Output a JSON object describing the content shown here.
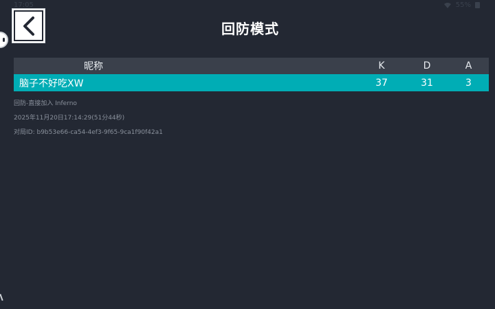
{
  "status_bar": {
    "time": "17:05",
    "battery": "55%"
  },
  "header": {
    "title": "回防模式"
  },
  "table": {
    "columns": {
      "name": "昵称",
      "k": "K",
      "d": "D",
      "a": "A"
    },
    "rows": [
      {
        "name": "脑子不好吃XW",
        "k": "37",
        "d": "31",
        "a": "3"
      }
    ]
  },
  "match_info": {
    "mode_map": "回防-直接加入 Inferno",
    "datetime": "2025年11月20日17:14:29(51分44秒)",
    "match_id": "对局ID: b9b53e66-ca54-4ef3-9f65-9ca1f90f42a1"
  },
  "colors": {
    "background": "#232833",
    "header_row": "#3a404b",
    "highlight_row": "#00adb5"
  }
}
